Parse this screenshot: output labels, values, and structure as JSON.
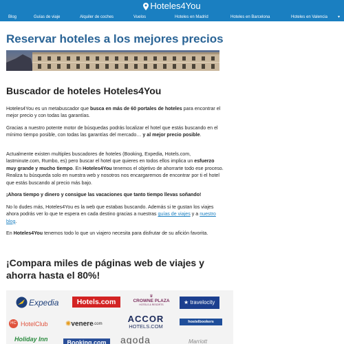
{
  "header": {
    "brand": "Hoteles4You",
    "pin_icon": "map-pin-icon",
    "accent_color": "#1a7fc1",
    "nav": [
      "Blog",
      "Guías de viaje",
      "Alquiler de coches",
      "Vuelos",
      "Hoteles en Madrid",
      "Hoteles en Barcelona",
      "Hoteles en Valencia"
    ],
    "nav_more_icon": "chevron-down-icon"
  },
  "main": {
    "title": "Reservar hoteles a los mejores precios",
    "search_heading": "Buscador de hoteles Hoteles4You",
    "p1": {
      "a": "Hoteles4You es un metabuscador que ",
      "b": "busca en más de 60 portales de hoteles",
      "c": " para encontrar el mejor precio y con todas las garantías."
    },
    "p2": {
      "a": "Gracias a nuestro potente motor de búsquedas podrás localizar el hotel que estás buscando en el mínimo tiempo posible, con todas las garantías del mercado… ",
      "b": "y al mejor precio posible",
      "c": "."
    },
    "p3": {
      "a": "Actualmente existen multiples buscadores de hoteles (Booking, Expedia, Hotels.com, lastminute.com, Rumbo, es) pero buscar el hotel que quieres en todos ellos implica un ",
      "b": "esfuerzo muy grande y mucho tiempo",
      "c": ". En ",
      "d": "Hoteles4You",
      "e": " tenemos el objetivo de ahorrarte todo ese proceso. Realiza tu búsqueda solo en nuestra web y nosotros nos encargaremos de encontrar por ti el hotel que estás buscando al precio más bajo."
    },
    "p4": "¡Ahora tiempo y dinero y consigue las vacaciones que tanto tiempo llevas soñando!",
    "p5": {
      "a": "No lo dudes más, Hoteles4You es la web que estabas buscando. Además si te gustan los viajes ahora podrás ver lo que te espera en cada destino gracias a nuestras ",
      "link1": "guías de viajes",
      "b": " y a ",
      "link2": "nuestro blog",
      "c": "."
    },
    "p6": {
      "a": "En ",
      "b": "Hoteles4You",
      "c": " tenemos todo lo que un viajero necesita para disfrutar de su afición favorita."
    },
    "compare_heading": "¡Compara miles de páginas web de viajes y ahorra hasta el 80%!"
  },
  "partners": {
    "expedia": "Expedia",
    "hotels_com": "Hotels.com",
    "crowne_plaza": "CROWNE PLAZA",
    "crowne_sub": "HOTELS & RESORTS",
    "travelocity": "travelocity",
    "hotelclub": "HotelClub",
    "venere": "venere",
    "venere_suffix": ".com",
    "accor": "ACCOR",
    "accor_sub": "HOTELS.COM",
    "hostelbookers": "hostelbookers",
    "holiday": "Holiday Inn",
    "booking": "Booking.com",
    "agoda": "agoda",
    "marriott": "Marriott"
  }
}
